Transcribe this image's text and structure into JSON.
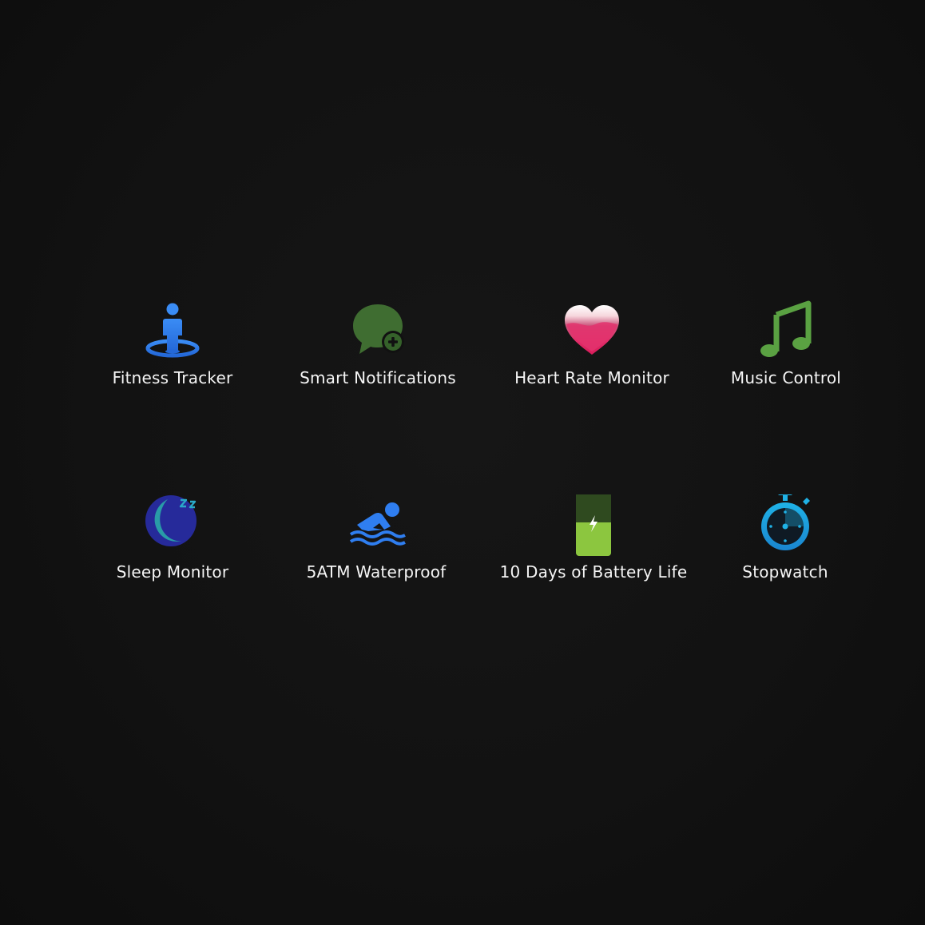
{
  "features": [
    {
      "label": "Fitness Tracker",
      "icon": "person-on-target-icon",
      "color": "#2f7ef0"
    },
    {
      "label": "Smart Notifications",
      "icon": "chat-bubble-plus-icon",
      "color": "#3d6b2f"
    },
    {
      "label": "Heart Rate Monitor",
      "icon": "heart-icon",
      "color": "#e0306a"
    },
    {
      "label": "Music Control",
      "icon": "music-note-icon",
      "color": "#5aa142"
    },
    {
      "label": "Sleep Monitor",
      "icon": "moon-zzz-icon",
      "color": "#2a2f9c"
    },
    {
      "label": "5ATM Waterproof",
      "icon": "swimmer-icon",
      "color": "#2f7ef0"
    },
    {
      "label": "10 Days of Battery Life",
      "icon": "battery-bolt-icon",
      "color": "#8cc63f"
    },
    {
      "label": "Stopwatch",
      "icon": "stopwatch-icon",
      "color": "#1fa4e6"
    }
  ]
}
